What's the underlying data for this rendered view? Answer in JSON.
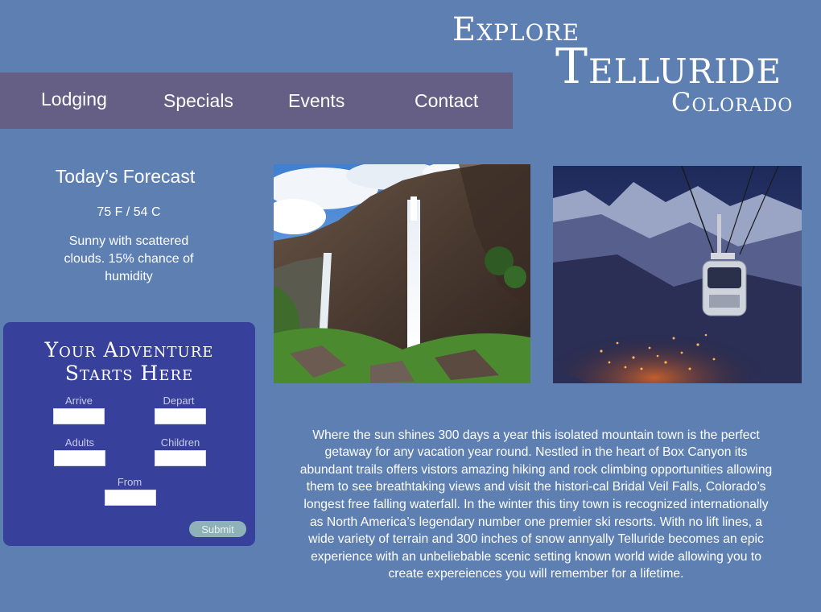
{
  "header": {
    "title_line1": "Explore",
    "title_line2": "Telluride",
    "title_line3": "Colorado"
  },
  "nav": {
    "items": [
      {
        "label": "Lodging"
      },
      {
        "label": "Specials"
      },
      {
        "label": "Events"
      },
      {
        "label": "Contact"
      }
    ]
  },
  "forecast": {
    "title": "Today’s Forecast",
    "temperature": "75 F / 54 C",
    "description": "Sunny with scattered clouds. 15% chance of humidity"
  },
  "booking": {
    "title_line1": "Your Adventure",
    "title_line2": "Starts Here",
    "fields": {
      "arrive": {
        "label": "Arrive",
        "value": ""
      },
      "depart": {
        "label": "Depart",
        "value": ""
      },
      "adults": {
        "label": "Adults",
        "value": ""
      },
      "children": {
        "label": "Children",
        "value": ""
      },
      "from": {
        "label": "From",
        "value": ""
      }
    },
    "submit_label": "Submit"
  },
  "photos": [
    {
      "subject": "waterfall-cliff",
      "icon": "photo-waterfall"
    },
    {
      "subject": "gondola-over-town-at-night",
      "icon": "photo-gondola"
    }
  ],
  "main": {
    "description": "Where the sun shines 300 days a year this isolated mountain town is the perfect getaway for any vacation year round. Nestled in the heart of Box Canyon its abundant trails offers vistors amazing hiking and rock climbing opportunities allowing them to see breathtaking views and visit the histori-cal Bridal Veil Falls, Colorado’s longest free falling waterfall. In the winter this tiny town is recognized internationally as North America’s legendary number one premier ski resorts. With no lift lines, a wide variety of terrain and 300 inches of snow annyally Telluride becomes an epic experience with an unbeliebable scenic setting known world wide allowing you to create expereiences you will remember for a lifetime."
  },
  "colors": {
    "page_background": "#5d7fb2",
    "nav_background": "#655f86",
    "booking_background": "#37409a",
    "submit_background": "#8fb1b8"
  }
}
